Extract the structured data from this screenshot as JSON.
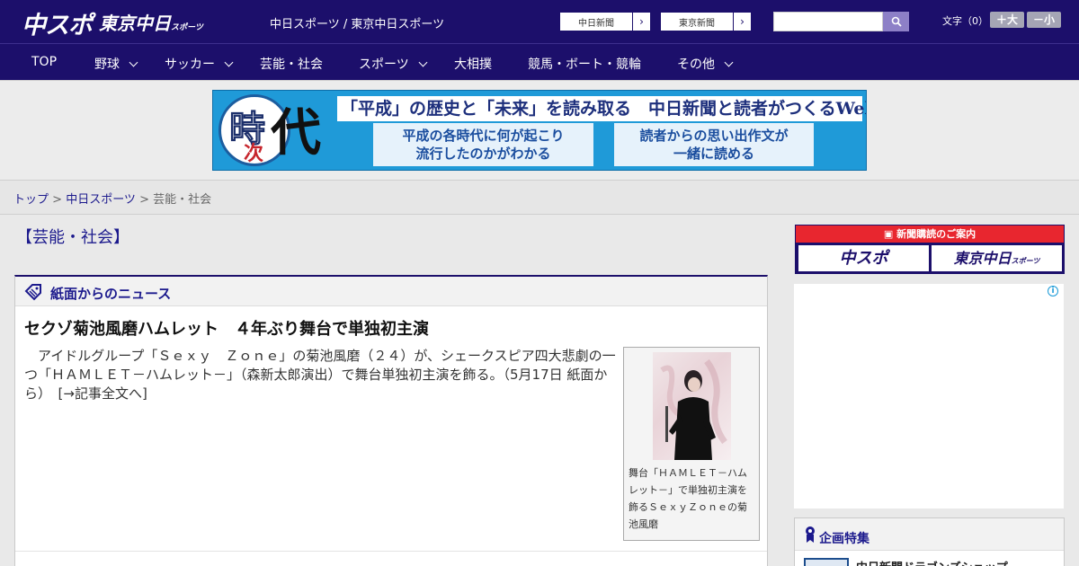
{
  "header": {
    "logo_chuspo": "中スポ",
    "logo_tokyo_chunichi": "東京中日",
    "logo_tokyo_chunichi_small": "スポーツ",
    "site_links": "中日スポーツ / 東京中日スポーツ",
    "paper_buttons": [
      {
        "label": "中日新聞"
      },
      {
        "label": "東京新聞"
      }
    ],
    "search": {
      "placeholder": "",
      "value": ""
    },
    "font_size_label": "文字（0）",
    "font_increase_label": "＋大",
    "font_decrease_label": "－小"
  },
  "nav": {
    "items": [
      {
        "label": "TOP",
        "has_dropdown": false
      },
      {
        "label": "野球",
        "has_dropdown": true
      },
      {
        "label": "サッカー",
        "has_dropdown": true
      },
      {
        "label": "芸能・社会",
        "has_dropdown": false
      },
      {
        "label": "スポーツ",
        "has_dropdown": true
      },
      {
        "label": "大相撲",
        "has_dropdown": false
      },
      {
        "label": "競馬・ボート・競輪",
        "has_dropdown": false
      },
      {
        "label": "その他",
        "has_dropdown": true
      }
    ]
  },
  "banner": {
    "kanji_toki": "時",
    "kanji_tsugi": "次",
    "kanji_dai": "代",
    "headline": "「平成」の歴史と「未来」を読み取る　中日新聞と読者がつくるWebサイト",
    "box_left_line1": "平成の各時代に何が起こり",
    "box_left_line2": "流行したのかがわかる",
    "box_right_line1": "読者からの思い出作文が",
    "box_right_line2": "一緒に読める"
  },
  "breadcrumb": {
    "home": "トップ",
    "sep1": " > ",
    "section": "中日スポーツ",
    "sep2": " > ",
    "current": "芸能・社会"
  },
  "page_title": "【芸能・社会】",
  "news_section": {
    "title": "紙面からのニュース",
    "headline": "セクゾ菊池風磨ハムレット　４年ぶり舞台で単独初主演",
    "body": "アイドルグループ「Ｓｅｘｙ　Ｚｏｎｅ」の菊池風磨（２４）が、シェークスピア四大悲劇の一つ「ＨＡＭＬＥＴ－ハムレット－」（森新太郎演出）で舞台単独初主演を飾る。（5月17日 紙面から）",
    "read_more": "[→記事全文へ]",
    "photo_caption": "舞台「ＨＡＭＬＥＴ－ハムレット－」で単独初主演を飾るＳｅｘｙＺｏｎｅの菊池風磨"
  },
  "sidebar": {
    "subscription_label": "新聞購読のご案内",
    "sub_logo_left": "中スポ",
    "sub_logo_right": "東京中日",
    "sub_logo_right_small": "スポーツ",
    "ad_info_icon": "i",
    "feature_title": "企画特集",
    "feature_item": "中日新聞ドラゴンズショップ"
  },
  "colors": {
    "header_bg": "#1c0f6b",
    "accent_red": "#e8262f",
    "link_blue": "#1c1a8d"
  }
}
